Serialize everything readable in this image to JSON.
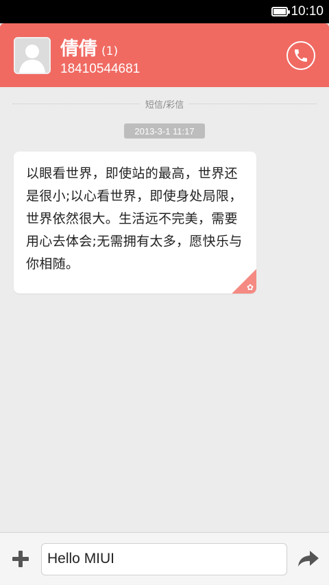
{
  "status_bar": {
    "time": "10:10",
    "battery_level": 1.0
  },
  "header": {
    "contact_name": "倩倩",
    "unread_count": "(1)",
    "phone_number": "18410544681",
    "accent_color": "#f06a62"
  },
  "thread": {
    "divider_label": "短信/彩信",
    "timestamp": "2013-3-1 11:17",
    "messages": [
      {
        "text": "以眼看世界，即使站的最高，世界还是很小;以心看世界，即使身处局限，世界依然很大。生活远不完美，需要用心去体会;无需拥有太多，愿快乐与你相随。"
      }
    ]
  },
  "composer": {
    "input_value": "Hello MIUI"
  },
  "icons": {
    "avatar": "default-avatar-icon",
    "call": "phone-icon",
    "add": "plus-icon",
    "send": "send-arrow-icon",
    "bubble_badge": "star-icon"
  }
}
